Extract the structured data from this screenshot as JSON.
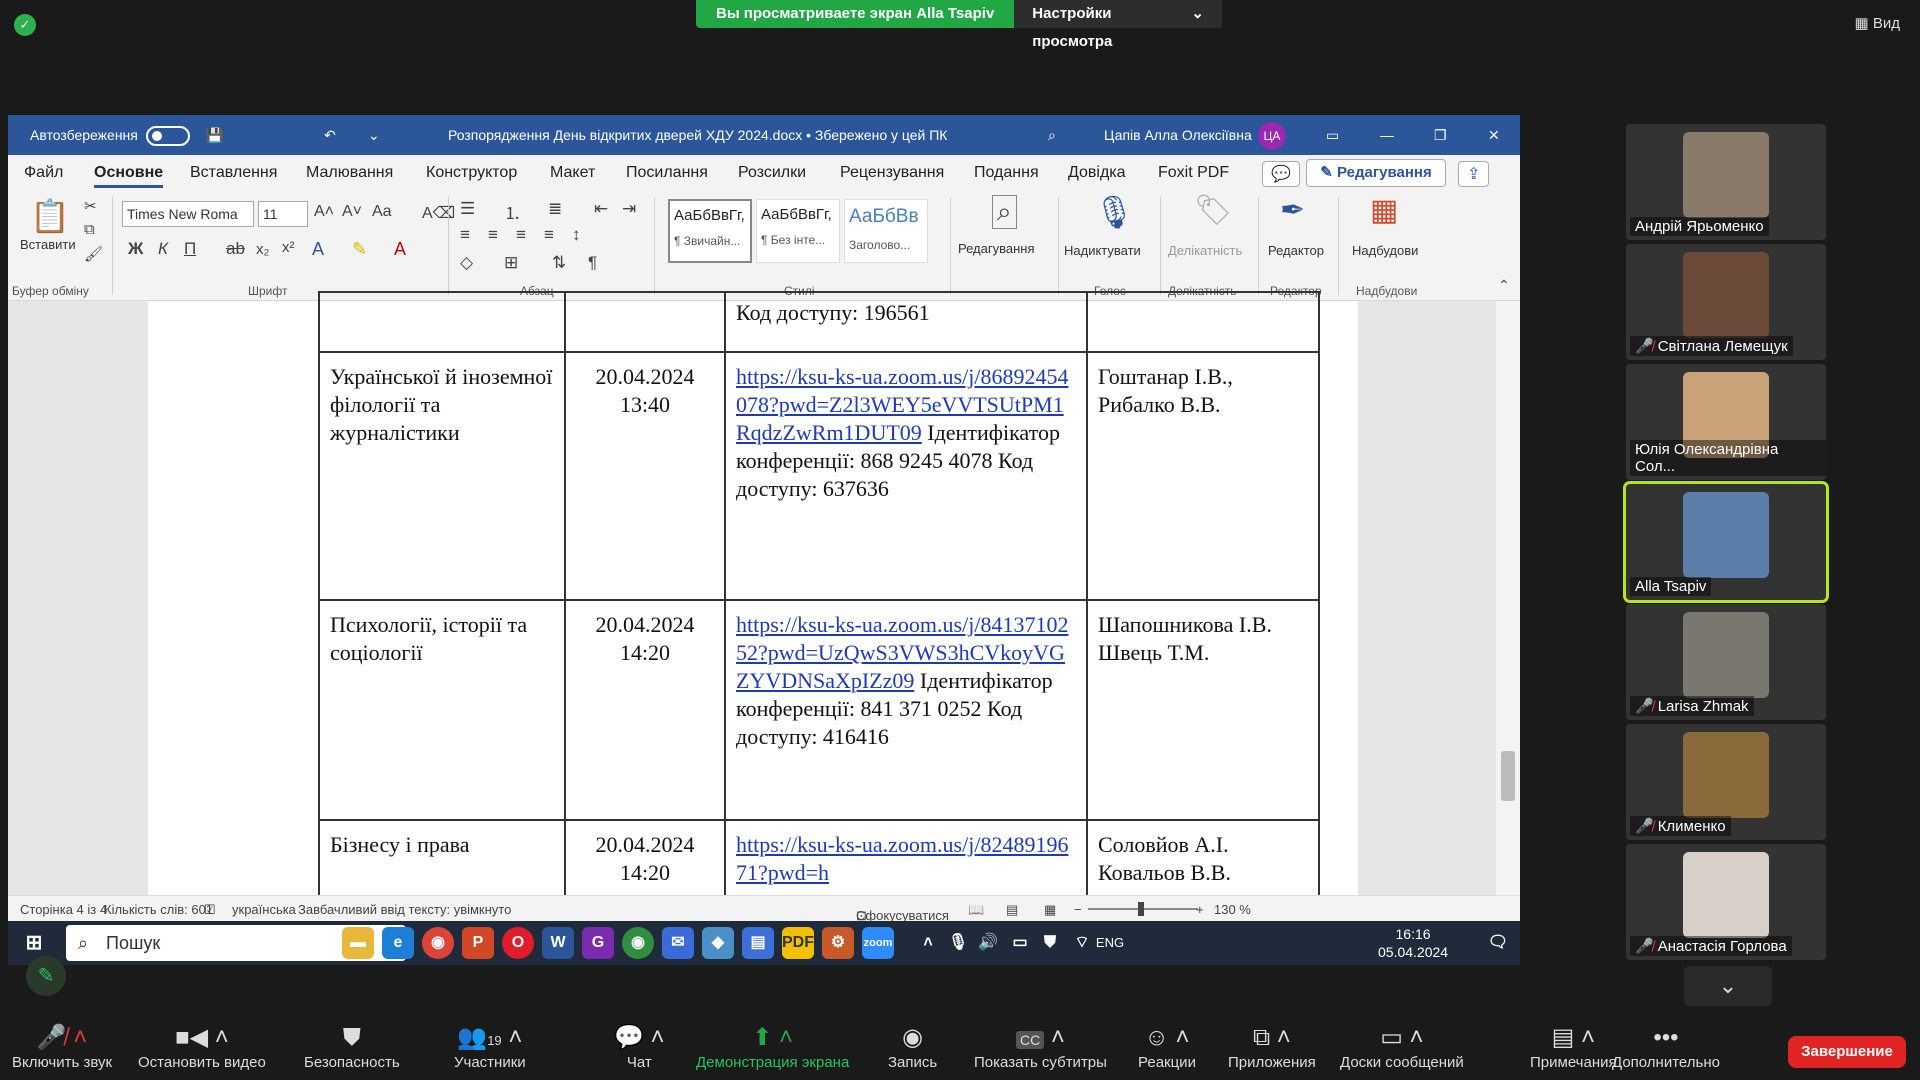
{
  "zoom": {
    "share_banner": "Вы просматриваете экран Alla Tsapiv",
    "view_options": "Настройки просмотра",
    "view_label": "Вид",
    "end_label": "Завершение",
    "toolbar": [
      {
        "label": "Включить звук",
        "icon": "mic-muted-icon"
      },
      {
        "label": "Остановить видео",
        "icon": "camera-icon"
      },
      {
        "label": "Безопасность",
        "icon": "shield-icon"
      },
      {
        "label": "Участники",
        "icon": "participants-icon",
        "count": "19"
      },
      {
        "label": "Чат",
        "icon": "chat-icon"
      },
      {
        "label": "Демонстрация экрана",
        "icon": "share-screen-icon"
      },
      {
        "label": "Запись",
        "icon": "record-icon"
      },
      {
        "label": "Показать субтитры",
        "icon": "cc-icon",
        "badge": "CC"
      },
      {
        "label": "Реакции",
        "icon": "reactions-icon"
      },
      {
        "label": "Приложения",
        "icon": "apps-icon"
      },
      {
        "label": "Доски сообщений",
        "icon": "whiteboard-icon"
      },
      {
        "label": "Примечания",
        "icon": "notes-icon"
      },
      {
        "label": "Дополнительно",
        "icon": "more-icon"
      }
    ],
    "participants": [
      {
        "name": "Андрій Ярьоменко",
        "muted": false,
        "color": "#8a7a6a"
      },
      {
        "name": "Світлана Лемещук",
        "muted": true,
        "color": "#6b4a3a"
      },
      {
        "name": "Юлія Олександрівна Сол...",
        "muted": false,
        "color": "#c9a27a"
      },
      {
        "name": "Alla Tsapiv",
        "muted": false,
        "color": "#5b7fa8",
        "active": true
      },
      {
        "name": "Larisa Zhmak",
        "muted": true,
        "color": "#7a7670"
      },
      {
        "name": "Клименко",
        "muted": true,
        "color": "#8a6a3a"
      },
      {
        "name": "Анастасія Горлова",
        "muted": true,
        "color": "#d8d0c8"
      }
    ]
  },
  "word": {
    "autosave_label": "Автозбереження",
    "doc_title": "Розпорядження День відкритих дверей ХДУ 2024.docx • Збережено у цей ПК",
    "user_name": "Цапів Алла Олексіївна",
    "user_initials": "ЦА",
    "menu": [
      "Файл",
      "Основне",
      "Вставлення",
      "Малювання",
      "Конструктор",
      "Макет",
      "Посилання",
      "Розсилки",
      "Рецензування",
      "Подання",
      "Довідка",
      "Foxit PDF"
    ],
    "edit_mode": "Редагування",
    "ribbon": {
      "paste": "Вставити",
      "clipboard": "Буфер обміну",
      "font_name": "Times New Roma",
      "font_size": "11",
      "font_group": "Шрифт",
      "paragraph_group": "Абзац",
      "styles": [
        {
          "sample": "АаБбВвГг,",
          "name": "¶ Звичайн..."
        },
        {
          "sample": "АаБбВвГг,",
          "name": "¶ Без інте..."
        },
        {
          "sample": "АаБбВв",
          "name": "Заголово..."
        }
      ],
      "styles_group": "Стилі",
      "editing": "Редагування",
      "dictate": "Надиктувати",
      "voice_group": "Голос",
      "sensitivity": "Делікатність",
      "sensitivity_group": "Делікатність",
      "editor": "Редактор",
      "editor_group": "Редактор",
      "addins": "Надбудови",
      "addins_group": "Надбудови"
    },
    "table": {
      "top_fragment": "Код доступу: 196561",
      "rows": [
        {
          "faculty": "Української й іноземної філології та журналістики",
          "date": "20.04.2024",
          "time": "13:40",
          "link": "https://ksu-ks-ua.zoom.us/j/86892454078?pwd=Z2l3WEY5eVVTSUtPM1RqdzZwRm1DUT09",
          "details": "Ідентифікатор конференції: 868 9245 4078 Код доступу: 637636",
          "responsible": "Гоштанар І.В., Рибалко В.В."
        },
        {
          "faculty": "Психології, історії та соціології",
          "date": "20.04.2024",
          "time": "14:20",
          "link": "https://ksu-ks-ua.zoom.us/j/8413710252?pwd=UzQwS3VWS3hCVkoyVGZYVDNSaXpIZz09",
          "details": "Ідентифікатор конференції: 841 371 0252 Код доступу: 416416",
          "responsible": "Шапошникова І.В. Швець Т.М."
        },
        {
          "faculty": "Бізнесу і права",
          "date": "20.04.2024",
          "time": "14:20",
          "link": "https://ksu-ks-ua.zoom.us/j/8248919671?pwd=h",
          "details": "",
          "responsible": "Соловйов А.І. Ковальов В.В."
        }
      ]
    },
    "status": {
      "page": "Сторінка 4 із 4",
      "words": "Кількість слів: 601",
      "lang": "українська",
      "predictive": "Завбачливий ввід тексту: увімкнуто",
      "focus": "Сфокусуватися",
      "zoom": "130 %"
    }
  },
  "windows": {
    "search": "Пошук",
    "lang": "ENG",
    "time": "16:16",
    "date": "05.04.2024"
  }
}
